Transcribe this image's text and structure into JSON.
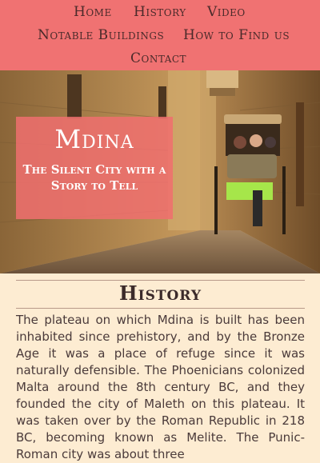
{
  "nav": {
    "home": "Home",
    "history": "History",
    "video": "Video",
    "notable_buildings": "Notable Buildings",
    "how_to_find_us": "How to Find us",
    "contact": "Contact"
  },
  "hero": {
    "title": "Mdina",
    "subtitle": "The Silent City with a Story to Tell"
  },
  "history": {
    "heading": "History",
    "paragraph": "The plateau on which Mdina is built has been inhabited since prehistory, and by the Bronze Age it was a place of refuge since it was naturally defensible. The Phoenicians colonized Malta around the 8th century BC, and they founded the city of Maleth on this plateau. It was taken over by the Roman Republic in 218 BC, becoming known as Melite. The Punic-Roman city was about three"
  },
  "colors": {
    "nav_bg": "#f07272",
    "page_bg": "#fdecd2",
    "hero_box": "#f06e6e",
    "carriage_seat": "#a6e64a"
  },
  "icons": [
    "hero-street-photo"
  ]
}
